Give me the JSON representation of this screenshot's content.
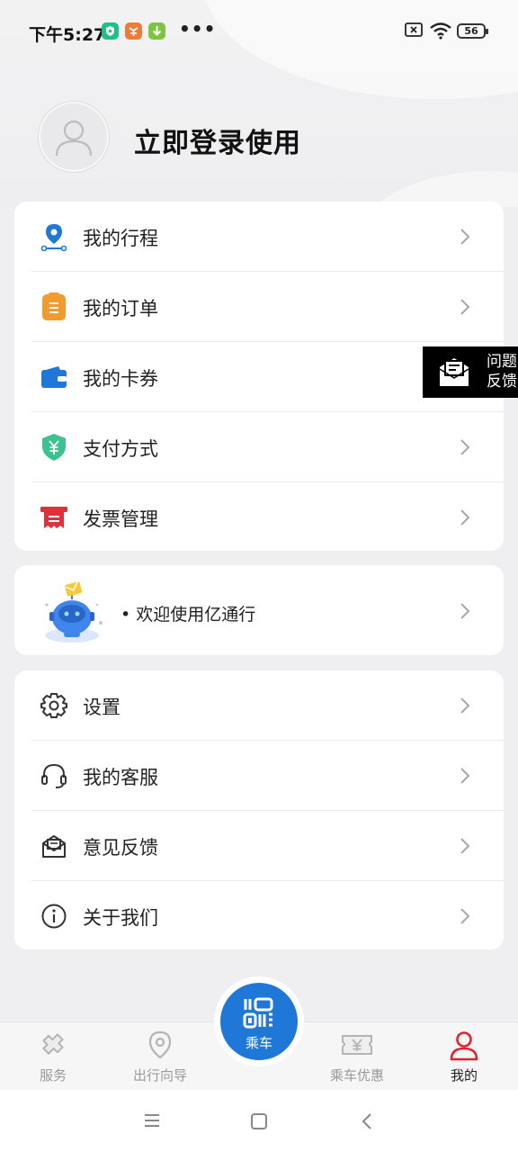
{
  "status_bar": {
    "time": "下午5:27",
    "battery": "56"
  },
  "profile": {
    "login_text": "立即登录使用"
  },
  "menu_group_1": [
    {
      "label": "我的行程",
      "icon": "location-route-icon"
    },
    {
      "label": "我的订单",
      "icon": "order-clipboard-icon"
    },
    {
      "label": "我的卡券",
      "icon": "wallet-icon"
    },
    {
      "label": "支付方式",
      "icon": "yuan-shield-icon"
    },
    {
      "label": "发票管理",
      "icon": "invoice-icon"
    }
  ],
  "welcome": {
    "bullet": "•",
    "text": "欢迎使用亿通行"
  },
  "menu_group_2": [
    {
      "label": "设置",
      "icon": "gear-icon"
    },
    {
      "label": "我的客服",
      "icon": "headset-icon"
    },
    {
      "label": "意见反馈",
      "icon": "feedback-mail-icon"
    },
    {
      "label": "关于我们",
      "icon": "info-icon"
    }
  ],
  "feedback_float": {
    "label": "问题反馈"
  },
  "tabbar": {
    "tabs": [
      {
        "label": "服务",
        "icon": "services-icon",
        "active": false
      },
      {
        "label": "出行向导",
        "icon": "map-pin-icon",
        "active": false
      },
      {
        "label": "乘车",
        "icon": "qr-code-icon",
        "active": false
      },
      {
        "label": "乘车优惠",
        "icon": "ticket-yuan-icon",
        "active": false
      },
      {
        "label": "我的",
        "icon": "user-icon",
        "active": true
      }
    ]
  },
  "colors": {
    "accent_blue": "#1f78d8",
    "active_red": "#e0242e",
    "orange": "#f39a2e",
    "green": "#3cc28e"
  }
}
